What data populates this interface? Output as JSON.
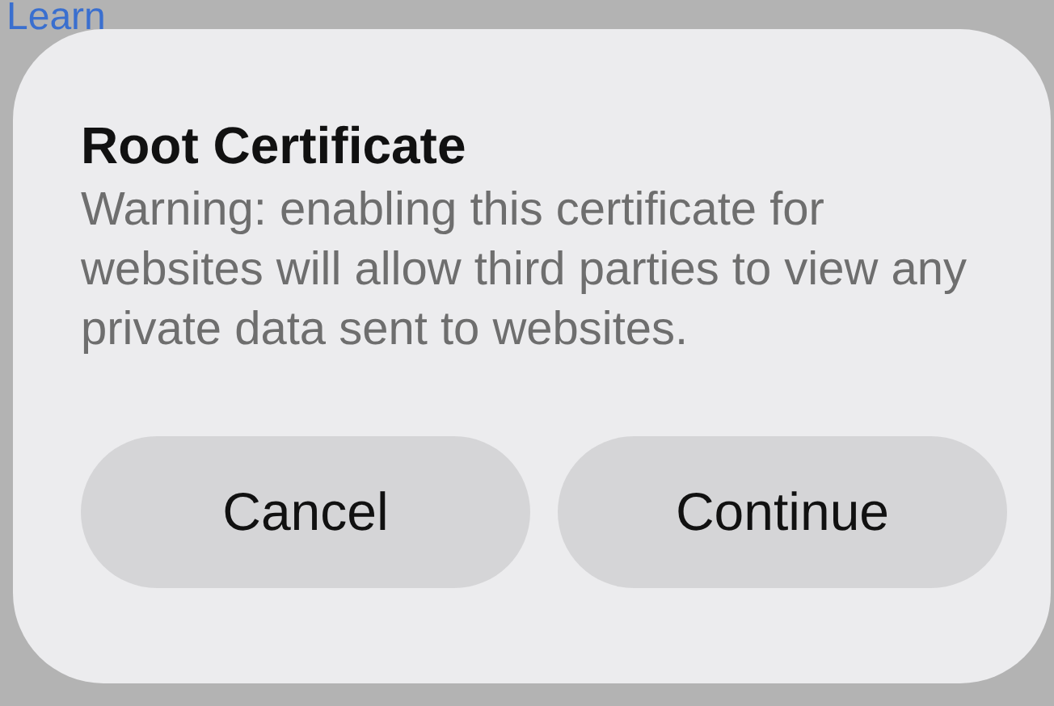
{
  "background_link": {
    "label": "Learn"
  },
  "dialog": {
    "title": "Root Certificate",
    "message": "Warning: enabling this certificate for websites will allow third parties to view any private data sent to websites.",
    "buttons": [
      {
        "label": "Cancel"
      },
      {
        "label": "Continue"
      }
    ]
  }
}
